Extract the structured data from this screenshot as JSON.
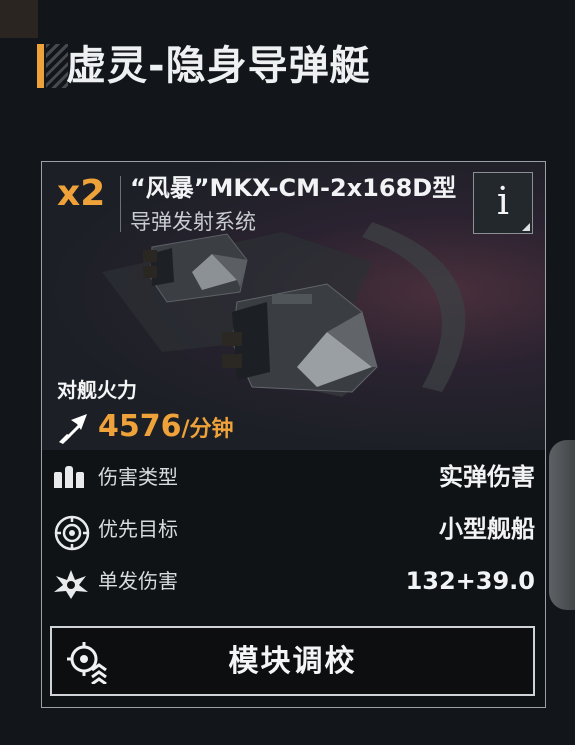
{
  "page": {
    "title": "虚灵-隐身导弹艇"
  },
  "module_card": {
    "count": "x2",
    "name": "“风暴”MKX-CM-2x168D型",
    "type": "导弹发射系统",
    "info_label": "i",
    "firepower": {
      "label": "对舰火力",
      "value": "4576",
      "unit": "/分钟"
    },
    "stats": [
      {
        "label": "伤害类型",
        "value": "实弹伤害",
        "icon": "ammo-icon"
      },
      {
        "label": "优先目标",
        "value": "小型舰船",
        "icon": "crosshair-icon"
      },
      {
        "label": "单发伤害",
        "value": "132+39.0",
        "icon": "explosion-icon"
      }
    ],
    "calibrate_label": "模块调校"
  },
  "colors": {
    "accent": "#f0a23a",
    "background": "#12161b",
    "card_border": "#9aa0a6"
  }
}
